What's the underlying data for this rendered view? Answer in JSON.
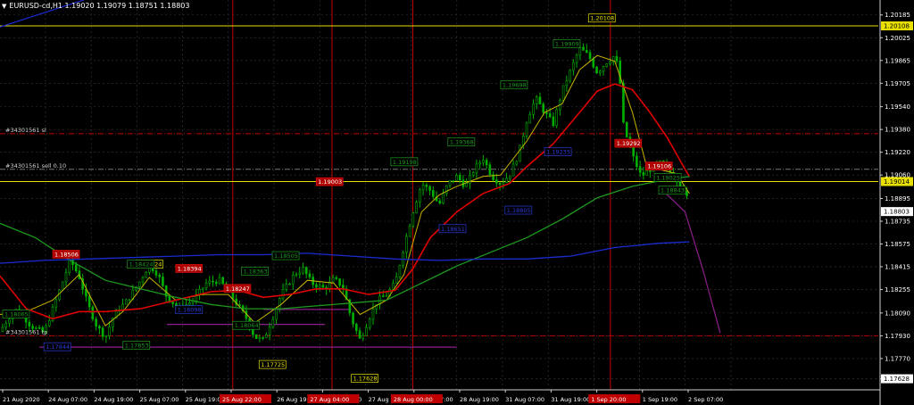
{
  "header": {
    "arrow": "▼",
    "title": "EURUSD-cd,H1  1.19020 1.19079 1.18751 1.18803"
  },
  "colors": {
    "bg": "#000000",
    "grid": "#3a3a3a",
    "bull": "#00b000",
    "bear": "#00b000",
    "ma_fast": "#c8b400",
    "ma_red": "#e00000",
    "ma_green": "#1d9a1d",
    "ma_blue": "#1a2bd0",
    "line_yellow": "#e8e000",
    "line_red": "#c00000",
    "line_purple": "#8a1e8a",
    "axis_text": "#ffffff",
    "last_price_bg": "#ffffff"
  },
  "price_axis": {
    "ticks": [
      "1.20185",
      "1.20025",
      "1.19865",
      "1.19705",
      "1.19540",
      "1.19380",
      "1.19220",
      "1.19060",
      "1.18895",
      "1.18735",
      "1.18575",
      "1.18415",
      "1.18255",
      "1.18090",
      "1.17930",
      "1.17770",
      "1.17628"
    ],
    "labels": [
      {
        "text": "1.20108",
        "value": 1.20108,
        "bg": "#e8e000",
        "fg": "#000000"
      },
      {
        "text": "1.19014",
        "value": 1.19014,
        "bg": "#e8e000",
        "fg": "#000000"
      },
      {
        "text": "1.18803",
        "value": 1.18803,
        "bg": "#ffffff",
        "fg": "#000000"
      },
      {
        "text": "1.17628",
        "value": 1.17628,
        "bg": "#ffffff",
        "fg": "#000000"
      }
    ]
  },
  "time_axis": {
    "labels": [
      "21 Aug 2020",
      "24 Aug 07:00",
      "24 Aug 19:00",
      "25 Aug 07:00",
      "25 Aug 19:00",
      "26 Aug 07:00",
      "26 Aug 19:00",
      "27 Aug 07:00",
      "27 Aug 19:00",
      "28 Aug 07:00",
      "28 Aug 19:00",
      "31 Aug 07:00",
      "31 Aug 19:00",
      "1 Sep 07:00",
      "1 Sep 19:00",
      "2 Sep 07:00"
    ],
    "highlighted": [
      "25 Aug 22:00",
      "27 Aug 04:00",
      "28 Aug 00:00",
      "1 Sep 20:00"
    ]
  },
  "trade_labels": [
    {
      "text": "#34301561 sl",
      "value": 1.1935
    },
    {
      "text": "#34301561 sell 0.10",
      "value": 1.191
    },
    {
      "text": "#34301561 tp",
      "value": 1.1793
    }
  ],
  "chart_data": {
    "type": "candlestick",
    "ylim": [
      1.1755,
      1.2029
    ],
    "symbol": "EURUSD-cd",
    "timeframe": "H1",
    "last": {
      "open": 1.1902,
      "high": 1.19079,
      "low": 1.18751,
      "close": 1.18803
    },
    "horizontal_lines": [
      {
        "value": 1.20108,
        "style": "solid",
        "color": "yellow"
      },
      {
        "value": 1.19014,
        "style": "solid",
        "color": "yellow"
      },
      {
        "value": 1.1935,
        "style": "dashdot",
        "color": "red"
      },
      {
        "value": 1.191,
        "style": "dashdot",
        "color": "gray"
      },
      {
        "value": 1.1793,
        "style": "dashdot",
        "color": "red"
      }
    ],
    "vertical_lines": [
      0.265,
      0.378,
      0.47,
      0.695
    ],
    "price_tags": [
      {
        "text": "1.20108",
        "x": 0.67,
        "value": 1.2016,
        "color": "yellow"
      },
      {
        "text": "1.19909",
        "x": 0.63,
        "value": 1.1998,
        "color": "green"
      },
      {
        "text": "1.19698",
        "x": 0.57,
        "value": 1.1969,
        "color": "green"
      },
      {
        "text": "1.19368",
        "x": 0.51,
        "value": 1.1929,
        "color": "green"
      },
      {
        "text": "1.19198",
        "x": 0.445,
        "value": 1.1915,
        "color": "green"
      },
      {
        "text": "1.19003",
        "x": 0.36,
        "value": 1.1901,
        "color": "red"
      },
      {
        "text": "1.19292",
        "x": 0.7,
        "value": 1.1928,
        "color": "red"
      },
      {
        "text": "1.19106",
        "x": 0.735,
        "value": 1.1912,
        "color": "red"
      },
      {
        "text": "1.19025",
        "x": 0.745,
        "value": 1.1904,
        "color": "green"
      },
      {
        "text": "1.18843",
        "x": 0.75,
        "value": 1.1895,
        "color": "green"
      },
      {
        "text": "1.19235",
        "x": 0.62,
        "value": 1.1922,
        "color": "blue"
      },
      {
        "text": "1.18805",
        "x": 0.575,
        "value": 1.1881,
        "color": "blue"
      },
      {
        "text": "1.18651",
        "x": 0.5,
        "value": 1.1868,
        "color": "blue"
      },
      {
        "text": "1.18506",
        "x": 0.06,
        "value": 1.185,
        "color": "red"
      },
      {
        "text": "1.18424",
        "x": 0.155,
        "value": 1.1843,
        "color": "yellow"
      },
      {
        "text": "1.18394",
        "x": 0.2,
        "value": 1.184,
        "color": "red"
      },
      {
        "text": "1.18363",
        "x": 0.275,
        "value": 1.1838,
        "color": "green"
      },
      {
        "text": "1.18505",
        "x": 0.31,
        "value": 1.1849,
        "color": "green"
      },
      {
        "text": "1.18424",
        "x": 0.145,
        "value": 1.1843,
        "color": "green"
      },
      {
        "text": "1.18247",
        "x": 0.255,
        "value": 1.1826,
        "color": "red"
      },
      {
        "text": "1.18098",
        "x": 0.2,
        "value": 1.1811,
        "color": "blue"
      },
      {
        "text": "1.18065",
        "x": 0.003,
        "value": 1.1808,
        "color": "green"
      },
      {
        "text": "1.18064",
        "x": 0.265,
        "value": 1.18,
        "color": "green"
      },
      {
        "text": "1.17844",
        "x": 0.05,
        "value": 1.1785,
        "color": "blue"
      },
      {
        "text": "1.17853",
        "x": 0.14,
        "value": 1.1786,
        "color": "green"
      },
      {
        "text": "1.17725",
        "x": 0.295,
        "value": 1.17725,
        "color": "yellow"
      },
      {
        "text": "1.17628",
        "x": 0.4,
        "value": 1.17628,
        "color": "yellow"
      }
    ],
    "close_path": [
      [
        0.0,
        1.1796
      ],
      [
        0.01,
        1.1806
      ],
      [
        0.02,
        1.1812
      ],
      [
        0.035,
        1.18
      ],
      [
        0.05,
        1.1795
      ],
      [
        0.065,
        1.182
      ],
      [
        0.08,
        1.1846
      ],
      [
        0.09,
        1.1835
      ],
      [
        0.1,
        1.1815
      ],
      [
        0.11,
        1.18
      ],
      [
        0.12,
        1.1792
      ],
      [
        0.13,
        1.1808
      ],
      [
        0.145,
        1.1818
      ],
      [
        0.16,
        1.1832
      ],
      [
        0.17,
        1.1843
      ],
      [
        0.18,
        1.1836
      ],
      [
        0.19,
        1.182
      ],
      [
        0.205,
        1.1812
      ],
      [
        0.22,
        1.1818
      ],
      [
        0.235,
        1.183
      ],
      [
        0.25,
        1.1832
      ],
      [
        0.26,
        1.1824
      ],
      [
        0.27,
        1.1815
      ],
      [
        0.28,
        1.1806
      ],
      [
        0.29,
        1.1792
      ],
      [
        0.3,
        1.179
      ],
      [
        0.31,
        1.1805
      ],
      [
        0.32,
        1.1822
      ],
      [
        0.335,
        1.1836
      ],
      [
        0.345,
        1.184
      ],
      [
        0.355,
        1.183
      ],
      [
        0.37,
        1.1826
      ],
      [
        0.38,
        1.1833
      ],
      [
        0.39,
        1.1828
      ],
      [
        0.4,
        1.1805
      ],
      [
        0.41,
        1.179
      ],
      [
        0.42,
        1.1805
      ],
      [
        0.43,
        1.1818
      ],
      [
        0.44,
        1.1822
      ],
      [
        0.45,
        1.183
      ],
      [
        0.46,
        1.1856
      ],
      [
        0.47,
        1.188
      ],
      [
        0.48,
        1.19
      ],
      [
        0.49,
        1.1895
      ],
      [
        0.5,
        1.1885
      ],
      [
        0.51,
        1.19
      ],
      [
        0.52,
        1.1905
      ],
      [
        0.53,
        1.1898
      ],
      [
        0.54,
        1.191
      ],
      [
        0.55,
        1.1918
      ],
      [
        0.56,
        1.1905
      ],
      [
        0.57,
        1.19
      ],
      [
        0.58,
        1.1906
      ],
      [
        0.59,
        1.192
      ],
      [
        0.6,
        1.1945
      ],
      [
        0.61,
        1.196
      ],
      [
        0.62,
        1.195
      ],
      [
        0.63,
        1.1942
      ],
      [
        0.64,
        1.1965
      ],
      [
        0.65,
        1.198
      ],
      [
        0.66,
        1.1995
      ],
      [
        0.67,
        1.199
      ],
      [
        0.68,
        1.1978
      ],
      [
        0.69,
        1.1985
      ],
      [
        0.7,
        1.199
      ],
      [
        0.705,
        1.1978
      ],
      [
        0.71,
        1.194
      ],
      [
        0.72,
        1.192
      ],
      [
        0.73,
        1.1905
      ],
      [
        0.74,
        1.191
      ],
      [
        0.75,
        1.1915
      ],
      [
        0.76,
        1.191
      ],
      [
        0.77,
        1.1903
      ],
      [
        0.78,
        1.1895
      ],
      [
        0.785,
        1.1882
      ]
    ],
    "series": [
      {
        "id": "ma_fast",
        "points": [
          [
            0.0,
            1.1808
          ],
          [
            0.03,
            1.181
          ],
          [
            0.06,
            1.1818
          ],
          [
            0.09,
            1.1836
          ],
          [
            0.1,
            1.1824
          ],
          [
            0.12,
            1.18
          ],
          [
            0.14,
            1.181
          ],
          [
            0.17,
            1.1834
          ],
          [
            0.2,
            1.1818
          ],
          [
            0.23,
            1.1822
          ],
          [
            0.26,
            1.1822
          ],
          [
            0.29,
            1.1802
          ],
          [
            0.32,
            1.1815
          ],
          [
            0.35,
            1.1832
          ],
          [
            0.38,
            1.183
          ],
          [
            0.41,
            1.1808
          ],
          [
            0.44,
            1.1818
          ],
          [
            0.46,
            1.1836
          ],
          [
            0.48,
            1.188
          ],
          [
            0.5,
            1.1892
          ],
          [
            0.52,
            1.1898
          ],
          [
            0.55,
            1.1905
          ],
          [
            0.57,
            1.1906
          ],
          [
            0.6,
            1.193
          ],
          [
            0.62,
            1.195
          ],
          [
            0.64,
            1.1956
          ],
          [
            0.66,
            1.198
          ],
          [
            0.68,
            1.199
          ],
          [
            0.7,
            1.1986
          ],
          [
            0.72,
            1.195
          ],
          [
            0.735,
            1.1915
          ],
          [
            0.75,
            1.191
          ],
          [
            0.77,
            1.1907
          ],
          [
            0.785,
            1.1893
          ]
        ]
      },
      {
        "id": "ma_red",
        "points": [
          [
            0.0,
            1.1835
          ],
          [
            0.03,
            1.1812
          ],
          [
            0.06,
            1.1805
          ],
          [
            0.09,
            1.181
          ],
          [
            0.12,
            1.181
          ],
          [
            0.16,
            1.1812
          ],
          [
            0.2,
            1.1818
          ],
          [
            0.24,
            1.1824
          ],
          [
            0.27,
            1.1825
          ],
          [
            0.3,
            1.182
          ],
          [
            0.33,
            1.1822
          ],
          [
            0.36,
            1.1826
          ],
          [
            0.39,
            1.1826
          ],
          [
            0.42,
            1.1822
          ],
          [
            0.45,
            1.1825
          ],
          [
            0.47,
            1.184
          ],
          [
            0.49,
            1.1862
          ],
          [
            0.52,
            1.188
          ],
          [
            0.55,
            1.1893
          ],
          [
            0.58,
            1.19
          ],
          [
            0.6,
            1.1912
          ],
          [
            0.63,
            1.1928
          ],
          [
            0.66,
            1.195
          ],
          [
            0.68,
            1.1965
          ],
          [
            0.7,
            1.197
          ],
          [
            0.72,
            1.1966
          ],
          [
            0.74,
            1.195
          ],
          [
            0.76,
            1.1932
          ],
          [
            0.78,
            1.191
          ],
          [
            0.785,
            1.1905
          ]
        ]
      },
      {
        "id": "ma_green",
        "points": [
          [
            0.0,
            1.1872
          ],
          [
            0.04,
            1.1862
          ],
          [
            0.08,
            1.1846
          ],
          [
            0.12,
            1.1832
          ],
          [
            0.16,
            1.1826
          ],
          [
            0.2,
            1.182
          ],
          [
            0.24,
            1.1815
          ],
          [
            0.28,
            1.1812
          ],
          [
            0.32,
            1.1812
          ],
          [
            0.36,
            1.1814
          ],
          [
            0.4,
            1.1816
          ],
          [
            0.44,
            1.1818
          ],
          [
            0.48,
            1.183
          ],
          [
            0.52,
            1.1842
          ],
          [
            0.56,
            1.1852
          ],
          [
            0.6,
            1.1862
          ],
          [
            0.64,
            1.1875
          ],
          [
            0.68,
            1.189
          ],
          [
            0.72,
            1.1898
          ],
          [
            0.76,
            1.1903
          ],
          [
            0.785,
            1.1905
          ]
        ]
      },
      {
        "id": "ma_blue",
        "points": [
          [
            0.0,
            1.1844
          ],
          [
            0.05,
            1.1846
          ],
          [
            0.1,
            1.1847
          ],
          [
            0.15,
            1.1848
          ],
          [
            0.2,
            1.1849
          ],
          [
            0.25,
            1.185
          ],
          [
            0.3,
            1.185
          ],
          [
            0.35,
            1.1851
          ],
          [
            0.4,
            1.1849
          ],
          [
            0.45,
            1.1847
          ],
          [
            0.5,
            1.1846
          ],
          [
            0.55,
            1.1847
          ],
          [
            0.6,
            1.1847
          ],
          [
            0.65,
            1.1849
          ],
          [
            0.7,
            1.1855
          ],
          [
            0.75,
            1.1858
          ],
          [
            0.785,
            1.1859
          ]
        ]
      },
      {
        "id": "ma_blue_top",
        "points": [
          [
            0.0,
            1.201
          ],
          [
            0.1,
            1.203
          ],
          [
            0.2,
            1.205
          ],
          [
            0.33,
            1.207
          ]
        ]
      },
      {
        "id": "purple_forecast",
        "points": [
          [
            0.755,
            1.1895
          ],
          [
            0.78,
            1.188
          ],
          [
            0.8,
            1.184
          ],
          [
            0.82,
            1.1795
          ]
        ]
      }
    ],
    "purple_segments": [
      {
        "from": 0.045,
        "to": 0.52,
        "value": 1.1785
      },
      {
        "from": 0.19,
        "to": 0.37,
        "value": 1.1801
      },
      {
        "from": 0.3,
        "to": 0.4,
        "value": 1.18115
      }
    ]
  }
}
